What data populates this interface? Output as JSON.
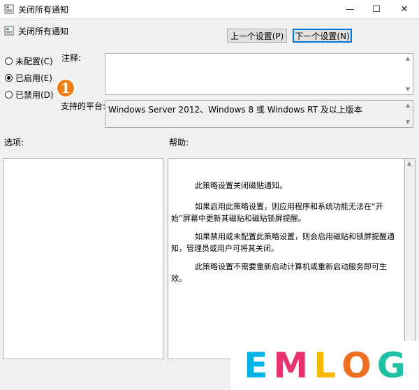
{
  "window": {
    "title": "关闭所有通知",
    "min_glyph": "—",
    "max_glyph": "☐",
    "close_glyph": "✕"
  },
  "header": {
    "setting_name": "关闭所有通知",
    "prev_button": "上一个设置(P)",
    "next_button": "下一个设置(N)"
  },
  "state": {
    "not_configured": "未配置(C)",
    "enabled": "已启用(E)",
    "disabled": "已禁用(D)",
    "selected": "enabled"
  },
  "badge": {
    "number": "1",
    "color": "#f07f16"
  },
  "comment": {
    "label": "注释:",
    "value": ""
  },
  "platform": {
    "label": "支持的平台:",
    "value": "Windows Server 2012、Windows 8 或 Windows RT 及以上版本"
  },
  "options": {
    "label": "选项:"
  },
  "help": {
    "label": "帮助:",
    "paragraphs": [
      "此策略设置关闭磁贴通知。",
      "如果启用此策略设置，则应用程序和系统功能无法在“开始”屏幕中更新其磁贴和磁贴锁屏提醒。",
      "如果禁用或未配置此策略设置，则会启用磁贴和锁屏提醒通知，管理员或用户可将其关闭。",
      "此策略设置不需要重新启动计算机或重新启动服务即可生效。"
    ]
  },
  "watermark": {
    "letters": [
      "E",
      "M",
      "L",
      "O",
      "G"
    ],
    "colors": [
      "#00b4e6",
      "#e8316f",
      "#f6b800",
      "#ee6f22",
      "#1fc0a3"
    ]
  }
}
